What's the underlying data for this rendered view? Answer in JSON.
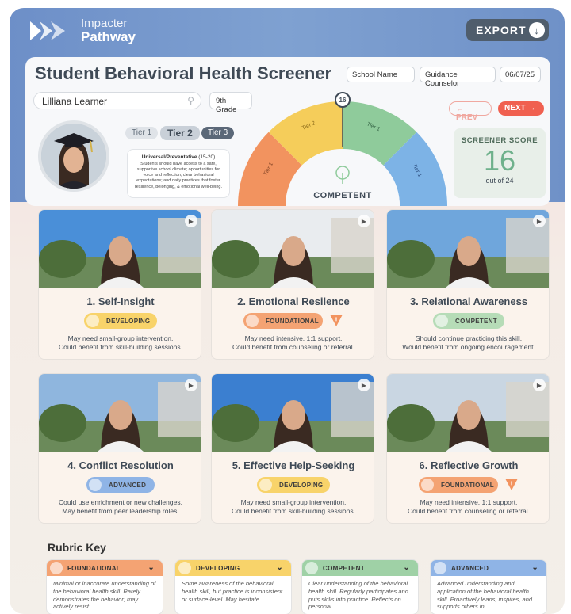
{
  "app": {
    "logo_line1": "Impacter",
    "logo_line2": "Pathway",
    "export_label": "EXPORT"
  },
  "header": {
    "title": "Student Behavioral Health Screener",
    "school_name": "School Name",
    "counselor": "Guidance Counselor",
    "date": "06/07/25"
  },
  "student": {
    "name": "Lilliana Learner",
    "grade": "9th Grade"
  },
  "tiers": {
    "tier1": "Tier 1",
    "tier2": "Tier 2",
    "tier3": "Tier 3",
    "info_heading": "Universal/Preventative",
    "info_range": "(15-20)",
    "info_body": "Students should have access to a safe, supportive school climate; opportunities for voice and reflection; clear behavioral expectations; and daily practices that foster resilience, belonging, & emotional well-being."
  },
  "gauge": {
    "marker_value": "16",
    "segment_labels": [
      "Tier 1",
      "Tier 2",
      "Tier 1",
      "Tier 1"
    ],
    "level_label": "COMPETENT"
  },
  "nav": {
    "prev": "PREV",
    "next": "NEXT"
  },
  "score": {
    "label": "SCREENER SCORE",
    "value": "16",
    "out_of": "out of 24"
  },
  "colors": {
    "foundational": "#f4a373",
    "developing": "#f8d36a",
    "competent": "#b6dcb7",
    "advanced": "#8fb4e6",
    "accent_red": "#f06050"
  },
  "skills": [
    {
      "title": "1. Self-Insight",
      "level": "DEVELOPING",
      "line1": "May need small-group intervention.",
      "line2": "Could benefit from skill-building sessions."
    },
    {
      "title": "2. Emotional Resilence",
      "level": "FOUNDATIONAL",
      "line1": "May need intensive, 1:1 support.",
      "line2": "Could benefit from counseling or referral."
    },
    {
      "title": "3. Relational Awareness",
      "level": "COMPETENT",
      "line1": "Should continue practicing this skill.",
      "line2": "Would benefit from ongoing encouragement."
    },
    {
      "title": "4. Conflict Resolution",
      "level": "ADVANCED",
      "line1": "Could use enrichment or new challenges.",
      "line2": "May benefit from peer leadership roles."
    },
    {
      "title": "5. Effective Help-Seeking",
      "level": "DEVELOPING",
      "line1": "May need small-group intervention.",
      "line2": "Could benefit from skill-building sessions."
    },
    {
      "title": "6. Reflective Growth",
      "level": "FOUNDATIONAL",
      "line1": "May need intensive, 1:1 support.",
      "line2": "Could benefit from counseling or referral."
    }
  ],
  "rubric": {
    "title": "Rubric Key",
    "items": [
      {
        "label": "FOUNDATIONAL",
        "text": "Minimal or inaccurate understanding of the behavioral health skill. Rarely demonstrates the behavior; may actively resist"
      },
      {
        "label": "DEVELOPING",
        "text": "Some awareness of the behavioral health skill, but practice is inconsistent or surface-level. May hesitate"
      },
      {
        "label": "COMPETENT",
        "text": "Clear understanding of the behavioral health skill. Regularly participates and puts skills into practice. Reflects on personal"
      },
      {
        "label": "ADVANCED",
        "text": "Advanced understanding and application of the behavioral health skill. Proactively leads, inspires, and supports others in"
      }
    ]
  }
}
